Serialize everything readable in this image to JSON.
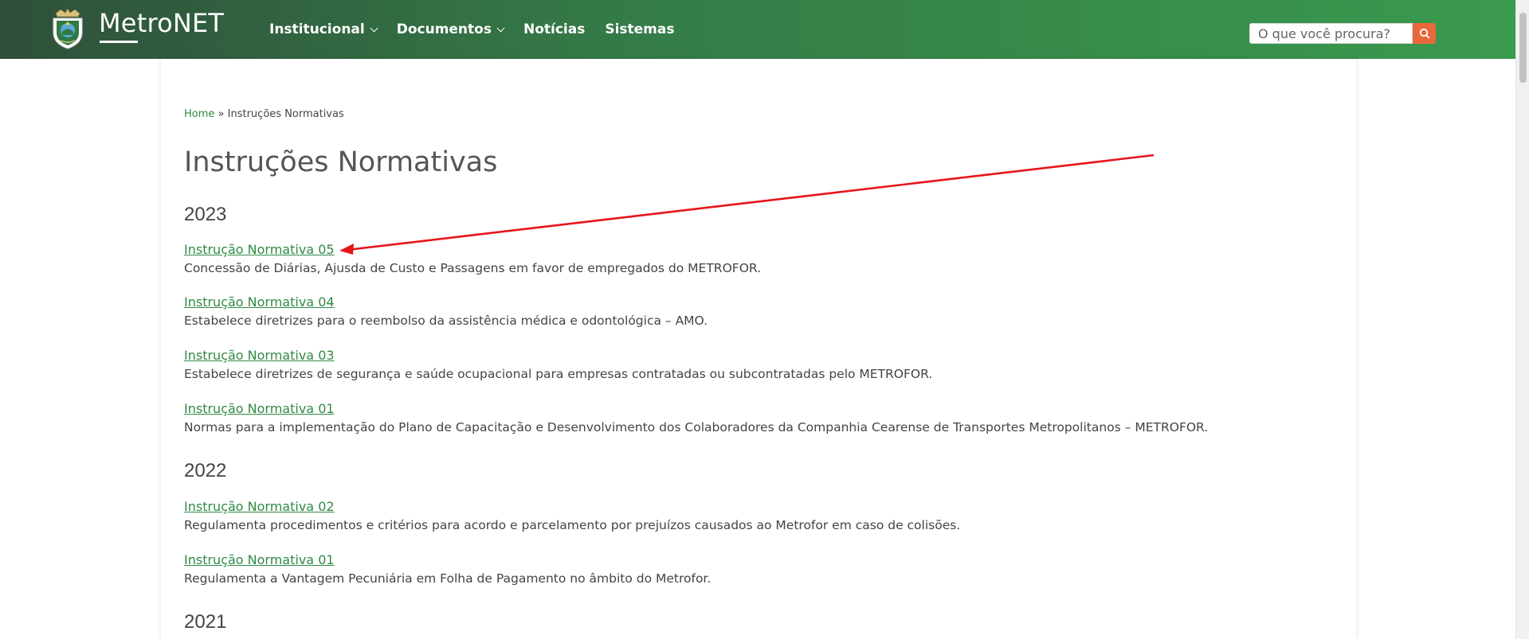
{
  "header": {
    "brand": "MetroNET",
    "nav": [
      {
        "label": "Institucional",
        "has_dropdown": true
      },
      {
        "label": "Documentos",
        "has_dropdown": true
      },
      {
        "label": "Notícias",
        "has_dropdown": false
      },
      {
        "label": "Sistemas",
        "has_dropdown": false
      }
    ],
    "search": {
      "placeholder": "O que você procura?",
      "button_icon": "search-icon"
    },
    "colors": {
      "bar_start": "#2f4f3a",
      "bar_end": "#3a9a4e",
      "search_button": "#e8683a"
    }
  },
  "breadcrumb": {
    "home": "Home",
    "separator": "»",
    "current": "Instruções Normativas"
  },
  "page_title": "Instruções Normativas",
  "sections": [
    {
      "year": "2023",
      "items": [
        {
          "title": "Instrução Normativa 05",
          "description": "Concessão de Diárias, Ajusda de Custo e Passagens em favor de empregados do METROFOR."
        },
        {
          "title": "Instrução Normativa 04",
          "description": "Estabelece diretrizes para o reembolso da assistência médica e odontológica – AMO."
        },
        {
          "title": "Instrução Normativa 03",
          "description": "Estabelece diretrizes de segurança e saúde ocupacional para empresas contratadas ou subcontratadas pelo METROFOR."
        },
        {
          "title": "Instrução Normativa 01",
          "description": "Normas para a implementação do Plano de Capacitação e Desenvolvimento dos Colaboradores da Companhia Cearense de Transportes Metropolitanos – METROFOR."
        }
      ]
    },
    {
      "year": "2022",
      "items": [
        {
          "title": "Instrução Normativa 02",
          "description": "Regulamenta procedimentos e critérios para acordo e parcelamento por prejuízos causados ao Metrofor em caso de colisões."
        },
        {
          "title": "Instrução Normativa 01",
          "description": "Regulamenta a Vantagem Pecuniária em Folha de Pagamento no âmbito do Metrofor."
        }
      ]
    },
    {
      "year": "2021",
      "items": []
    }
  ],
  "annotation": {
    "type": "red-arrow",
    "color": "#e8141b"
  }
}
